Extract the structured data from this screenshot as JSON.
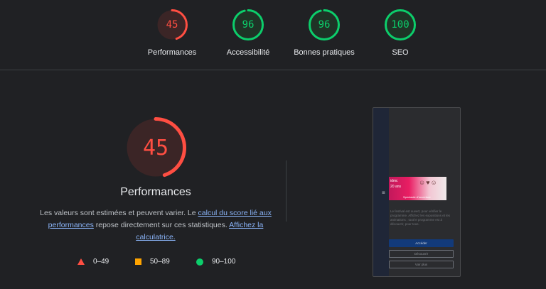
{
  "categories": [
    {
      "label": "Performances",
      "score": "45",
      "value": 45,
      "color": "#ff4e42",
      "bg": "#3b2526"
    },
    {
      "label": "Accessibilité",
      "score": "96",
      "value": 96,
      "color": "#0cce6b",
      "bg": "#1f3326"
    },
    {
      "label": "Bonnes pratiques",
      "score": "96",
      "value": 96,
      "color": "#0cce6b",
      "bg": "#1f3326"
    },
    {
      "label": "SEO",
      "score": "100",
      "value": 100,
      "color": "#0cce6b",
      "bg": "#1f3326"
    }
  ],
  "main": {
    "score": "45",
    "value": 45,
    "color": "#ff4e42",
    "bg": "#3b2526",
    "title": "Performances",
    "desc_text_1": "Les valeurs sont estimées et peuvent varier. Le ",
    "desc_link_1": "calcul du score lié aux performances",
    "desc_text_2": " repose directement sur ces statistiques. ",
    "desc_link_2": "Affichez la calculatrice."
  },
  "legend": [
    {
      "range": "0–49",
      "icon": "triangle-icon",
      "color": "#ff4e42"
    },
    {
      "range": "50–89",
      "icon": "square-icon",
      "color": "#ffa400"
    },
    {
      "range": "90–100",
      "icon": "circle-icon",
      "color": "#0cce6b"
    }
  ],
  "screenshot": {
    "menu_icon": "≡",
    "banner_line_1": "idmc",
    "banner_line_2": "20 ans",
    "banner_figures": "☺♥☺",
    "banner_caption": "Spectacle d’ouverture",
    "body_text": "Le festival est ouvert, pour vérifier le programme. Affichez les expositions et les animations ; tout le programme est à découvrir, pour tous.",
    "button_primary": "Accéder",
    "button_secondary": "Découvrir",
    "button_tertiary": "Voir plus"
  }
}
